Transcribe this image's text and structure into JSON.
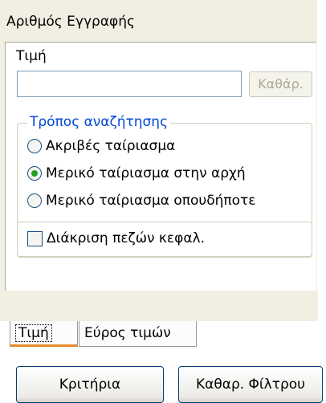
{
  "panel": {
    "title": "Αριθμός Εγγραφής"
  },
  "value": {
    "label": "Τιμή",
    "input_value": "",
    "clear_button": "Καθάρ."
  },
  "search_mode": {
    "legend": "Τρόπος αναζήτησης",
    "options": [
      {
        "label": "Ακριβές ταίριασμα",
        "checked": false
      },
      {
        "label": "Μερικό ταίριασμα στην αρχή",
        "checked": true
      },
      {
        "label": "Μερικό ταίριασμα οπουδήποτε",
        "checked": false
      }
    ]
  },
  "case_sensitive": {
    "label": "Διάκριση πεζών κεφαλ.",
    "checked": false
  },
  "tabs": [
    {
      "label": "Τιμή",
      "active": true
    },
    {
      "label": "Εύρος τιμών",
      "active": false
    }
  ],
  "buttons": {
    "criteria": "Κριτήρια",
    "clear_filter": "Καθαρ. Φίλτρου"
  },
  "colors": {
    "panel_bg": "#f1efe2",
    "legend_text": "#0046d5",
    "active_tab_accent": "#e68b2c",
    "radio_dot": "#21a121"
  }
}
